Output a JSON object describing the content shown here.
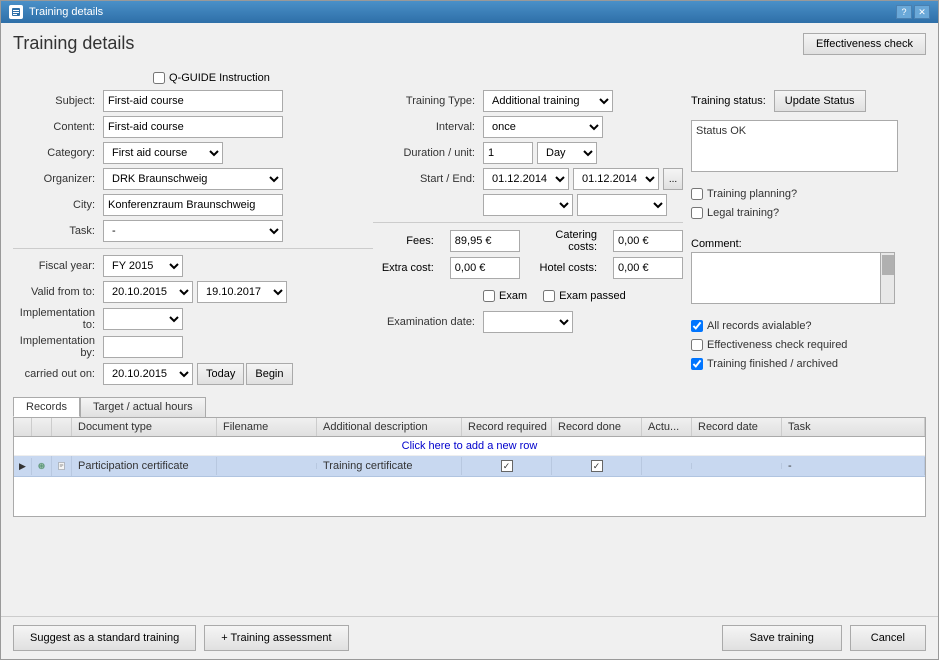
{
  "window": {
    "title": "Training details",
    "page_title": "Training details"
  },
  "header": {
    "effectiveness_check_label": "Effectiveness check"
  },
  "qguide": {
    "label": "Q-GUIDE Instruction"
  },
  "form": {
    "subject_label": "Subject:",
    "subject_value": "First-aid course",
    "content_label": "Content:",
    "content_value": "First-aid course",
    "category_label": "Category:",
    "category_value": "First aid course",
    "category_options": [
      "First aid course"
    ],
    "organizer_label": "Organizer:",
    "organizer_value": "DRK Braunschweig",
    "city_label": "City:",
    "city_value": "Konferenzraum Braunschweig",
    "task_label": "Task:",
    "task_value": "-",
    "training_type_label": "Training Type:",
    "training_type_value": "Additional training",
    "training_type_options": [
      "Additional training"
    ],
    "interval_label": "Interval:",
    "interval_value": "once",
    "interval_options": [
      "once"
    ],
    "duration_label": "Duration / unit:",
    "duration_value": "1",
    "day_value": "Day",
    "day_options": [
      "Day"
    ],
    "start_end_label": "Start / End:",
    "start_date": "01.12.2014",
    "end_date": "01.12.2014",
    "fiscal_label": "Fiscal year:",
    "fiscal_value": "FY 2015",
    "fiscal_options": [
      "FY 2015"
    ],
    "valid_from_label": "Valid from to:",
    "valid_from": "20.10.2015",
    "valid_to": "19.10.2017",
    "impl_to_label": "Implementation to:",
    "impl_by_label": "Implementation by:",
    "carried_label": "carried out on:",
    "carried_value": "20.10.2015",
    "today_btn": "Today",
    "begin_btn": "Begin",
    "fees_label": "Fees:",
    "fees_value": "89,95 €",
    "extra_cost_label": "Extra cost:",
    "extra_cost_value": "0,00 €",
    "catering_label": "Catering costs:",
    "catering_value": "0,00 €",
    "hotel_label": "Hotel costs:",
    "hotel_value": "0,00 €",
    "exam_label": "Exam",
    "exam_passed_label": "Exam passed",
    "exam_date_label": "Examination date:",
    "training_status_label": "Training status:",
    "update_status_btn": "Update Status",
    "status_value": "Status OK",
    "training_planning_label": "Training planning?",
    "legal_training_label": "Legal training?",
    "comment_label": "Comment:",
    "all_records_label": "All records avialable?",
    "effectiveness_check_req_label": "Effectiveness check required",
    "training_finished_label": "Training finished / archived"
  },
  "tabs": {
    "records_label": "Records",
    "target_label": "Target / actual hours"
  },
  "table": {
    "headers": {
      "expand": "",
      "icon1": "",
      "icon2": "",
      "document_type": "Document type",
      "filename": "Filename",
      "additional_description": "Additional description",
      "record_required": "Record required",
      "record_done": "Record done",
      "actu": "Actu...",
      "record_date": "Record date",
      "task": "Task"
    },
    "add_row_label": "Click here to add a new row",
    "rows": [
      {
        "document_type": "Participation certificate",
        "filename": "",
        "additional_description": "Training certificate",
        "record_required": true,
        "record_done": true,
        "actu": "",
        "record_date": "",
        "task": "-"
      }
    ]
  },
  "buttons": {
    "suggest_label": "Suggest as a standard training",
    "training_assess_label": "+ Training assessment",
    "save_label": "Save training",
    "cancel_label": "Cancel"
  },
  "record_label": "Record"
}
